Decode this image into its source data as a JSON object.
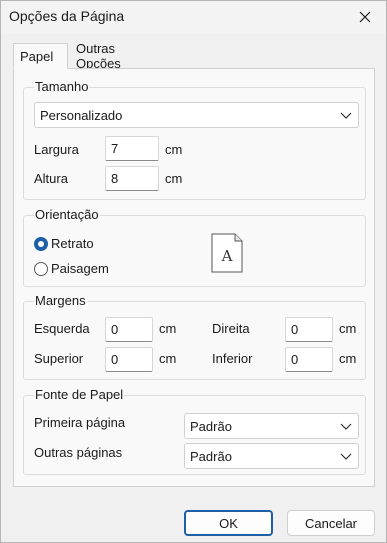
{
  "window": {
    "title": "Opções da Página"
  },
  "tabs": [
    {
      "label": "Papel",
      "active": true
    },
    {
      "label": "Outras Opções",
      "active": false
    }
  ],
  "tamanho": {
    "title": "Tamanho",
    "preset": "Personalizado",
    "largura": {
      "label": "Largura",
      "value": "7",
      "unit": "cm"
    },
    "altura": {
      "label": "Altura",
      "value": "8",
      "unit": "cm"
    }
  },
  "orientacao": {
    "title": "Orientação",
    "options": [
      {
        "label": "Retrato",
        "selected": true
      },
      {
        "label": "Paisagem",
        "selected": false
      }
    ],
    "preview_letter": "A"
  },
  "margens": {
    "title": "Margens",
    "esquerda": {
      "label": "Esquerda",
      "value": "0",
      "unit": "cm"
    },
    "direita": {
      "label": "Direita",
      "value": "0",
      "unit": "cm"
    },
    "superior": {
      "label": "Superior",
      "value": "0",
      "unit": "cm"
    },
    "inferior": {
      "label": "Inferior",
      "value": "0",
      "unit": "cm"
    }
  },
  "fonte": {
    "title": "Fonte de Papel",
    "primeira": {
      "label": "Primeira página",
      "value": "Padrão"
    },
    "outras": {
      "label": "Outras páginas",
      "value": "Padrão"
    }
  },
  "buttons": {
    "ok": "OK",
    "cancel": "Cancelar"
  },
  "colors": {
    "accent": "#1f5fa8",
    "panel": "#f9f9f9",
    "window": "#f0f0f0"
  },
  "icons": {
    "close": "close-icon",
    "dropdown": "chevron-down-icon",
    "orientation_preview": "portrait-page-icon"
  }
}
